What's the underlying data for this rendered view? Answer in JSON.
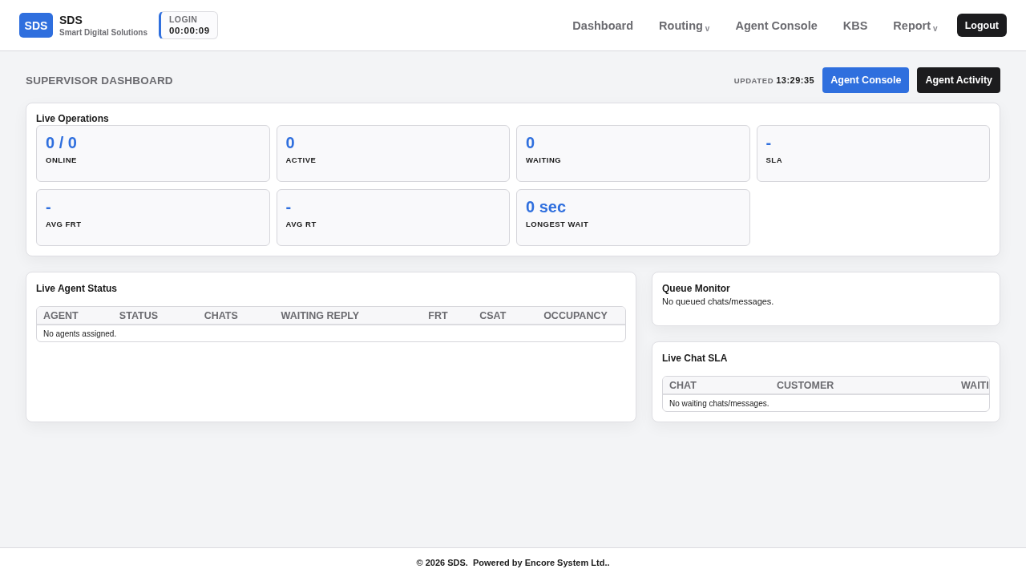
{
  "header": {
    "logo": {
      "mark": "SDS",
      "name": "SDS",
      "tagline": "Smart Digital Solutions"
    },
    "login_timer": {
      "label": "LOGIN",
      "value": "00:00:09"
    },
    "nav": [
      {
        "label": "Dashboard"
      },
      {
        "label": "Routing",
        "caret": "v"
      },
      {
        "label": "Agent Console"
      },
      {
        "label": "KBS"
      },
      {
        "label": "Report",
        "caret": "v"
      }
    ],
    "logout": "Logout"
  },
  "page": {
    "title": "SUPERVISOR DASHBOARD",
    "updated_label": "UPDATED",
    "updated_time": "13:29:35",
    "actions": [
      {
        "label": "Agent Console",
        "kind": "primary"
      },
      {
        "label": "Agent Activity",
        "kind": "dark"
      }
    ]
  },
  "live_operations": {
    "title": "Live Operations",
    "metrics": [
      {
        "value": "0 / 0",
        "label": "ONLINE"
      },
      {
        "value": "0",
        "label": "ACTIVE"
      },
      {
        "value": "0",
        "label": "WAITING"
      },
      {
        "value": "-",
        "label": "SLA"
      },
      {
        "value": "-",
        "label": "AVG FRT"
      },
      {
        "value": "-",
        "label": "AVG RT"
      },
      {
        "value": "0 sec",
        "label": "LONGEST WAIT"
      }
    ]
  },
  "live_agent_status": {
    "title": "Live Agent Status",
    "table": {
      "columns": [
        "AGENT",
        "STATUS",
        "CHATS",
        "WAITING REPLY",
        "FRT",
        "CSAT",
        "OCCUPANCY"
      ],
      "empty_message": "No agents assigned."
    }
  },
  "queue_monitor": {
    "title": "Queue Monitor",
    "message": "No queued chats/messages."
  },
  "live_chat_sla": {
    "title": "Live Chat SLA",
    "table": {
      "columns": [
        "CHAT",
        "CUSTOMER",
        "WAITI"
      ],
      "empty_message": "No waiting chats/messages."
    }
  },
  "footer": "© 2026 SDS.  Powered by Encore System Ltd.."
}
